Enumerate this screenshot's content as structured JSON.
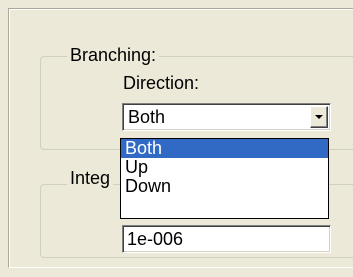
{
  "branching": {
    "legend": "Branching:",
    "direction_label": "Direction:",
    "combo_value": "Both",
    "options": [
      "Both",
      "Up",
      "Down"
    ],
    "selected_index": 0
  },
  "integ": {
    "legend": "Integ",
    "value": "1e-006"
  },
  "colors": {
    "selection": "#316AC5",
    "window_bg": "#ECE9D8"
  },
  "icons": {
    "combo_arrow": "chevron-down-icon"
  }
}
